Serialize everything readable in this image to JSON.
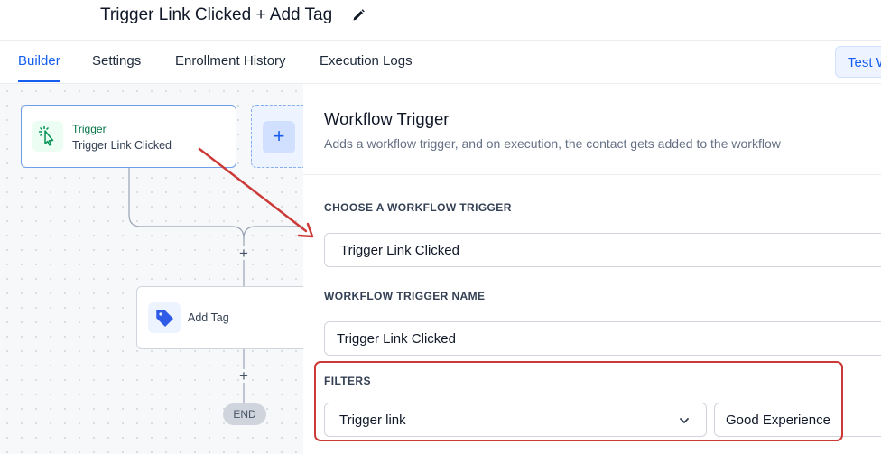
{
  "header": {
    "title": "Trigger Link Clicked + Add Tag",
    "edit_icon": "pencil-icon"
  },
  "tabs": [
    {
      "label": "Builder",
      "active": true
    },
    {
      "label": "Settings",
      "active": false
    },
    {
      "label": "Enrollment History",
      "active": false
    },
    {
      "label": "Execution Logs",
      "active": false
    }
  ],
  "test_button": {
    "label": "Test Workflow"
  },
  "canvas": {
    "trigger_node": {
      "label": "Trigger",
      "name": "Trigger Link Clicked",
      "icon": "cursor-click-icon"
    },
    "add_trigger_icon": "plus",
    "action_node": {
      "name": "Add Tag",
      "icon": "tag-icon"
    },
    "plus_symbol": "+",
    "end_label": "END"
  },
  "panel": {
    "title": "Workflow Trigger",
    "subtitle": "Adds a workflow trigger, and on execution, the contact gets added to the workflow",
    "choose_trigger_label": "CHOOSE A WORKFLOW TRIGGER",
    "choose_trigger_value": "Trigger Link Clicked",
    "trigger_name_label": "WORKFLOW TRIGGER NAME",
    "trigger_name_value": "Trigger Link Clicked",
    "filters_label": "FILTERS",
    "filter_field": "Trigger link",
    "filter_value": "Good Experience"
  },
  "colors": {
    "accent": "#155eef",
    "trigger_green": "#067647",
    "annotation_red": "#cc3a37"
  }
}
